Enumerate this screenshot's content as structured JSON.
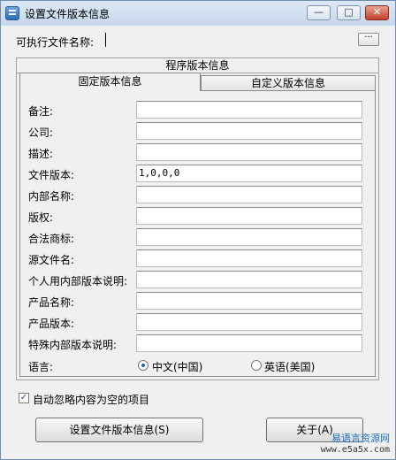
{
  "window": {
    "title": "设置文件版本信息",
    "minimize_label": "—",
    "maximize_label": "□",
    "close_label": "✕"
  },
  "exe": {
    "label": "可执行文件名称:",
    "value": "",
    "browse_label": "···"
  },
  "group": {
    "title": "程序版本信息"
  },
  "tabs": [
    {
      "label": "固定版本信息",
      "active": true
    },
    {
      "label": "自定义版本信息",
      "active": false
    }
  ],
  "fields": [
    {
      "label": "备注:",
      "value": ""
    },
    {
      "label": "公司:",
      "value": ""
    },
    {
      "label": "描述:",
      "value": ""
    },
    {
      "label": "文件版本:",
      "value": "1,0,0,0"
    },
    {
      "label": "内部名称:",
      "value": ""
    },
    {
      "label": "版权:",
      "value": ""
    },
    {
      "label": "合法商标:",
      "value": ""
    },
    {
      "label": "源文件名:",
      "value": ""
    },
    {
      "label": "个人用内部版本说明:",
      "value": ""
    },
    {
      "label": "产品名称:",
      "value": ""
    },
    {
      "label": "产品版本:",
      "value": ""
    },
    {
      "label": "特殊内部版本说明:",
      "value": ""
    }
  ],
  "language": {
    "label": "语言:",
    "options": [
      {
        "label": "中文(中国)",
        "checked": true
      },
      {
        "label": "英语(美国)",
        "checked": false
      }
    ]
  },
  "skip_empty": {
    "label": "自动忽略内容为空的项目",
    "checked": true
  },
  "buttons": {
    "set_label": "设置文件版本信息(S)",
    "about_label": "关于(A)"
  },
  "watermark": {
    "line1": "易语言资源网",
    "line2": "www.e5a5x.com"
  },
  "colors": {
    "titlebar": "#c7d7ec",
    "close_button": "#c2402b",
    "radio_dot": "#2264b8",
    "watermark": "#1a6fc0"
  }
}
